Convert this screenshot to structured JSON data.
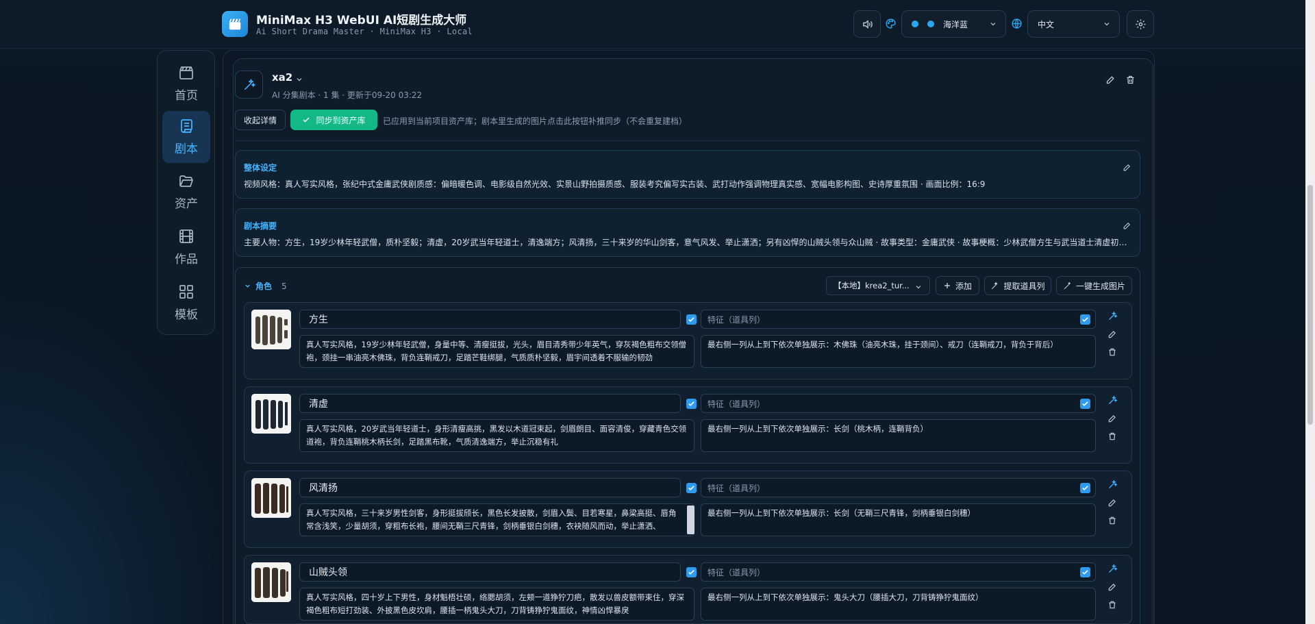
{
  "header": {
    "title": "MiniMax H3 WebUI AI短剧生成大师",
    "subtitle": "Ai Short Drama Master · MiniMax H3 · Local",
    "theme_label": "海洋蓝",
    "language_label": "中文",
    "accent_color": "#2aa7f0"
  },
  "sidebar": {
    "items": [
      {
        "label": "首页",
        "icon": "clapperboard-icon"
      },
      {
        "label": "剧本",
        "icon": "scroll-icon",
        "active": true
      },
      {
        "label": "资产",
        "icon": "folder-open-icon"
      },
      {
        "label": "作品",
        "icon": "film-icon"
      },
      {
        "label": "模板",
        "icon": "grid-icon"
      }
    ]
  },
  "script": {
    "name": "xa2",
    "meta": "AI 分集剧本 · 1 集 · 更新于09-20 03:22",
    "collapse_label": "收起详情",
    "sync_label": "同步到资产库",
    "sync_note": "已应用到当前项目资产库；剧本里生成的图片点击此按钮补推同步（不会重复建档）"
  },
  "overall": {
    "title": "整体设定",
    "text": "视频风格：真人写实风格，张纪中式金庸武侠剧质感：偏暗暖色调、电影级自然光效、实景山野拍摄质感、服装考究偏写实古装、武打动作强调物理真实感、宽幅电影构图、史诗厚重氛围 · 画面比例：16:9"
  },
  "summary": {
    "title": "剧本摘要",
    "text": "主要人物：方生，19岁少林年轻武僧，质朴坚毅；清虚，20岁武当年轻道士，清逸端方；风清扬，三十来岁的华山剑客，意气风发、举止潇洒；另有凶悍的山贼头领与众山贼 · 故事类型：金庸武侠 · 故事梗概：少林武僧方生与武当道士清虚初出江湖行..."
  },
  "roles": {
    "title": "角色",
    "count": "5",
    "model_label": "【本地】krea2_tur...",
    "add_label": "添加",
    "extract_label": "提取道具列",
    "generate_label": "一键生成图片",
    "feature_placeholder": "特征（道具列）",
    "items": [
      {
        "name": "方生",
        "desc": "真人写实风格，19岁少林年轻武僧，身量中等、清瘦挺拔，光头，眉目清秀带少年英气，穿灰褐色粗布交领僧袍，颈挂一串油亮木佛珠，背负连鞘戒刀，足踏芒鞋绑腿，气质质朴坚毅，眉宇间透着不服输的韧劲",
        "props": "最右侧一列从上到下依次单独展示：木佛珠（油亮木珠，挂于颈间）、戒刀（连鞘戒刀，背负于背后）"
      },
      {
        "name": "清虚",
        "desc": "真人写实风格，20岁武当年轻道士，身形清瘦高挑，黑发以木道冠束起，剑眉朗目、面容清俊，穿藏青色交领道袍，背负连鞘桃木柄长剑，足踏黑布靴，气质清逸端方，举止沉稳有礼",
        "props": "最右侧一列从上到下依次单独展示：长剑（桃木柄，连鞘背负）"
      },
      {
        "name": "风清扬",
        "desc": "真人写实风格，三十来岁男性剑客，身形挺拔颀长，黑色长发披散，剑眉入鬓、目若寒星，鼻梁高挺、唇角常含浅笑，少量胡须，穿粗布长袍，腰间无鞘三尺青锋，剑柄垂银白剑穗，衣袂随风而动，举止潇洒、",
        "props": "最右侧一列从上到下依次单独展示：长剑（无鞘三尺青锋，剑柄垂银白剑穗）"
      },
      {
        "name": "山贼头领",
        "desc": "真人写实风格，四十岁上下男性，身材魁梧壮硕，络腮胡须，左颊一道狰狞刀疤，散发以兽皮额带束住，穿深褐色粗布短打劲装、外披黑色皮坎肩，腰插一柄鬼头大刀，刀背铸狰狞鬼面纹，神情凶悍暴戾",
        "props": "最右侧一列从上到下依次单独展示：鬼头大刀（腰插大刀，刀背铸狰狞鬼面纹）"
      }
    ]
  }
}
